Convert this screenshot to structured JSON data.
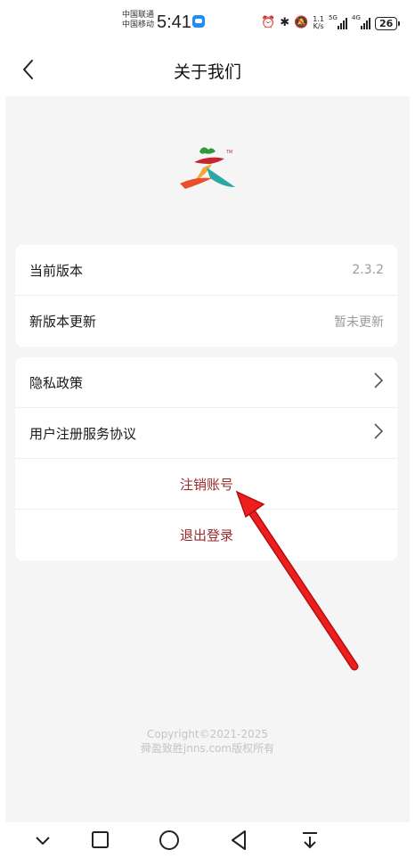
{
  "status_bar": {
    "carrier_1": "中国联通",
    "carrier_2": "中国移动",
    "time": "5:41",
    "speed_value": "1.1",
    "speed_unit": "K/s",
    "signal_1_label": "5G",
    "signal_2_label": "4G",
    "battery": "26",
    "icons": [
      "message-icon",
      "alarm-icon",
      "bluetooth-icon",
      "mute-icon"
    ]
  },
  "header": {
    "title": "关于我们",
    "back_icon": "chevron-left-icon"
  },
  "logo": {
    "name": "app-logo",
    "trademark": "TM",
    "colors": [
      "#2e9b3a",
      "#f2a93b",
      "#e94f2a",
      "#2ba7a4",
      "#c8242f"
    ]
  },
  "version_card": {
    "rows": [
      {
        "label": "当前版本",
        "value": "2.3.2"
      },
      {
        "label": "新版本更新",
        "value": "暂未更新"
      }
    ]
  },
  "actions_card": {
    "privacy_label": "隐私政策",
    "agreement_label": "用户注册服务协议",
    "cancel_account_label": "注销账号",
    "logout_label": "退出登录"
  },
  "footer": {
    "copyright": "Copyright©2021-2025",
    "company": "舜盈致胜jnns.com版权所有"
  },
  "nav_bar": {
    "icons": [
      "chevron-down-icon",
      "square-icon",
      "circle-icon",
      "triangle-back-icon",
      "pull-down-icon"
    ]
  },
  "colors": {
    "danger_text": "#9c2a2a",
    "arrow": "#e51b1b",
    "background": "#f5f5f5"
  }
}
